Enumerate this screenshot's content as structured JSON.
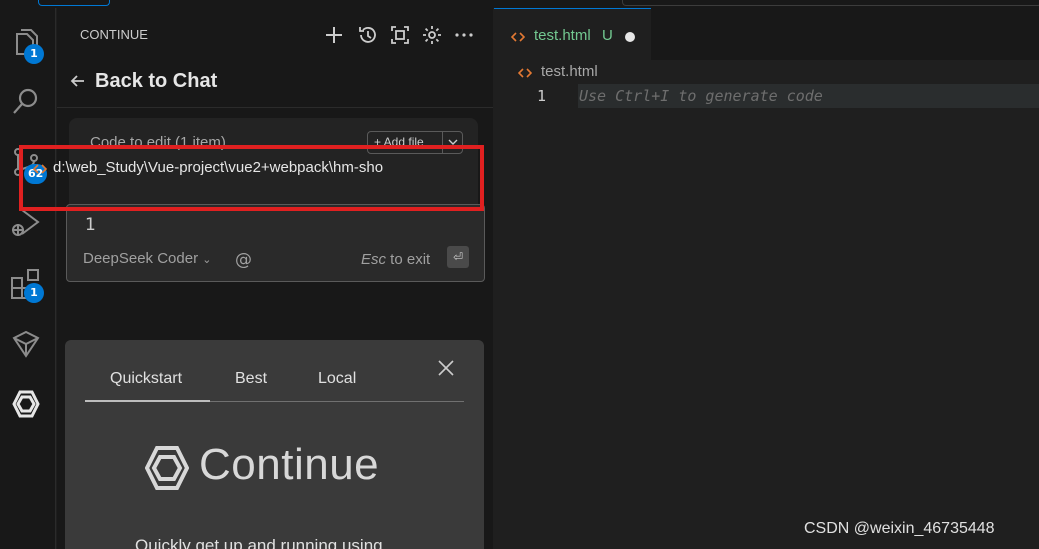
{
  "sidebar": {
    "title": "CONTINUE",
    "back_label": "Back to Chat",
    "edit_label": "Code to edit (1 item)",
    "add_file_label": "+ Add file",
    "file_path": "d:\\web_Study\\Vue-project\\vue2+webpack\\hm-sho",
    "input_text": "1",
    "model_label": "DeepSeek Coder",
    "at_symbol": "@",
    "esc_key": "Esc",
    "esc_suffix": " to exit",
    "enter_symbol": "⏎"
  },
  "activity_badges": {
    "explorer": "1",
    "source_control": "62",
    "extensions": "1"
  },
  "onboarding": {
    "tabs": [
      "Quickstart",
      "Best",
      "Local"
    ],
    "active_tab": "Quickstart",
    "brand": "Continue",
    "description": "Quickly get up and running using"
  },
  "editor": {
    "tab_name": "test.html",
    "tab_status": "U",
    "breadcrumb": "test.html",
    "line_number": "1",
    "ghost_text": "Use Ctrl+I to generate code"
  },
  "watermark": "CSDN @weixin_46735448",
  "colors": {
    "accent": "#0078d4",
    "highlight_box": "#e02020",
    "untracked_green": "#73c991",
    "html_icon": "#e37933"
  }
}
